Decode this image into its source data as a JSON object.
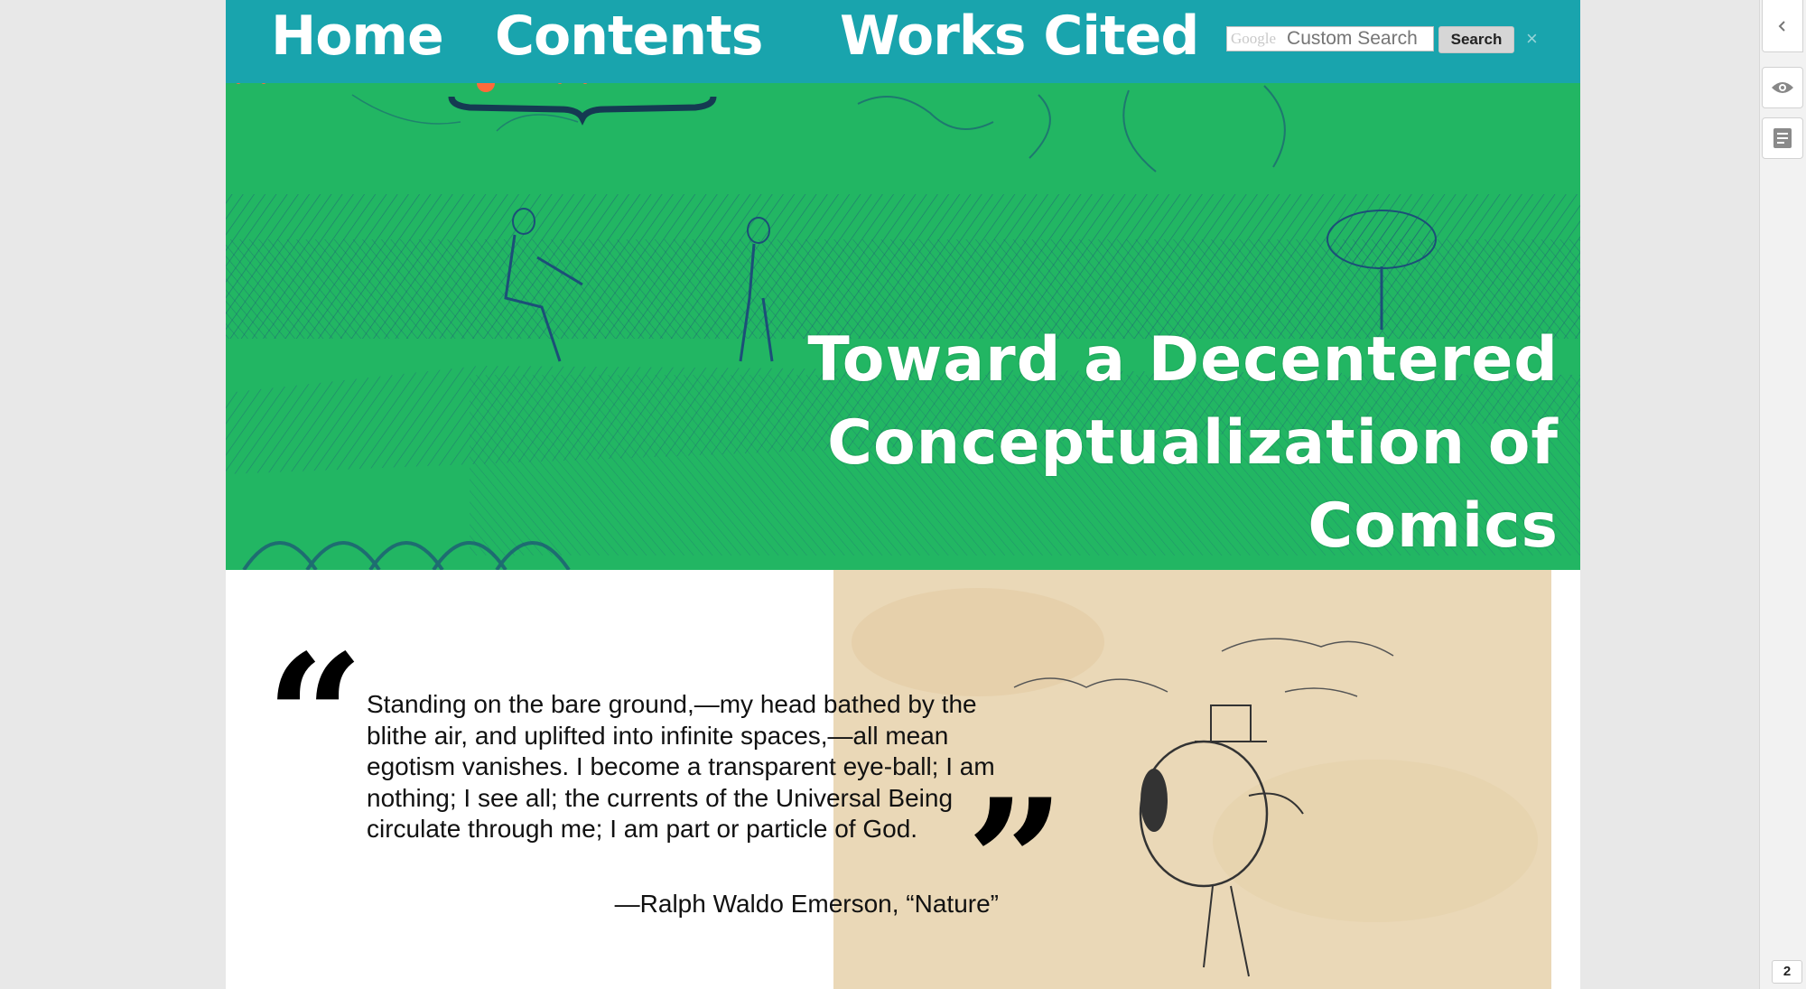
{
  "nav": {
    "links": [
      {
        "label": "Home"
      },
      {
        "label": "Contents"
      },
      {
        "label": "Works Cited"
      }
    ],
    "search": {
      "brand": "Google",
      "placeholder": "Custom Search",
      "button_label": "Search",
      "clear_glyph": "×"
    }
  },
  "hero": {
    "title_lines": [
      "Toward a Decentered",
      "Conceptualization of",
      "Comics"
    ]
  },
  "quote": {
    "open_mark": "“",
    "close_mark": "”",
    "text": "Standing on the bare ground,—my head bathed by the blithe air, and uplifted into infinite spaces,—all mean egotism vanishes. I become a transparent eye-ball; I am nothing; I see all; the currents of the Universal Being circulate through me; I am part or particle of God.",
    "attribution": "—Ralph Waldo Emerson, “Nature”"
  },
  "rail": {
    "collapse_icon": "chevron-left-icon",
    "view_icon": "eye-icon",
    "notes_icon": "notes-icon",
    "page_count": "2"
  },
  "colors": {
    "nav_bg": "#19a4ad",
    "hero_bg": "#22b663",
    "hero_line": "#1c4f78",
    "accent_dot": "#ff6a3a",
    "sketch_bg": "#ead8b7"
  }
}
